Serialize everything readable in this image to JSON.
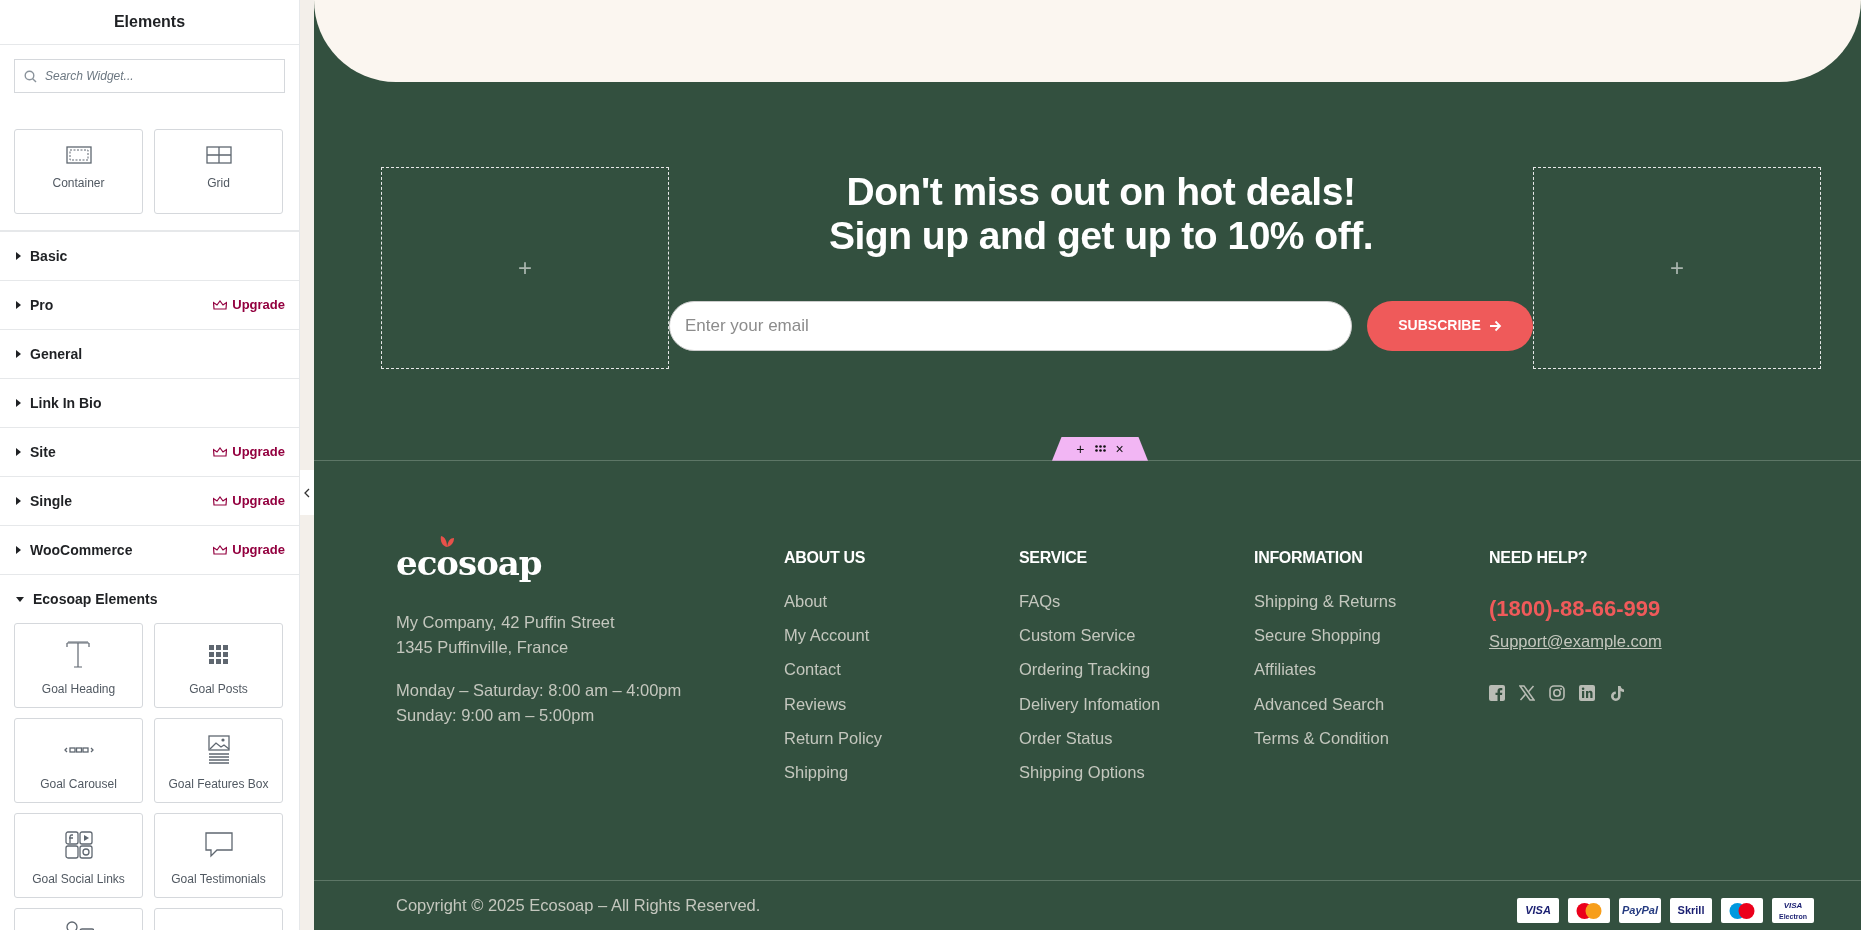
{
  "sidebar": {
    "title": "Elements",
    "search": {
      "placeholder": "Search Widget..."
    },
    "layout_widgets": [
      {
        "label": "Container"
      },
      {
        "label": "Grid"
      }
    ],
    "categories": [
      {
        "label": "Basic",
        "expanded": false
      },
      {
        "label": "Pro",
        "expanded": false,
        "badge": "Upgrade"
      },
      {
        "label": "General",
        "expanded": false
      },
      {
        "label": "Link In Bio",
        "expanded": false
      },
      {
        "label": "Site",
        "expanded": false,
        "badge": "Upgrade"
      },
      {
        "label": "Single",
        "expanded": false,
        "badge": "Upgrade"
      },
      {
        "label": "WooCommerce",
        "expanded": false,
        "badge": "Upgrade"
      },
      {
        "label": "Ecosoap Elements",
        "expanded": true
      }
    ],
    "widgets": [
      {
        "label": "Goal Heading"
      },
      {
        "label": "Goal Posts"
      },
      {
        "label": "Goal Carousel"
      },
      {
        "label": "Goal Features Box"
      },
      {
        "label": "Goal Social Links"
      },
      {
        "label": "Goal Testimonials"
      },
      {
        "kind": "cut"
      },
      {
        "kind": "cut"
      }
    ]
  },
  "newsletter": {
    "heading_lines": [
      "Don't miss out on hot deals!",
      "Sign up and get up to 10% off."
    ],
    "email": {
      "placeholder": "Enter your email"
    },
    "button": "SUBSCRIBE",
    "empty_columns": [
      "+",
      "+"
    ]
  },
  "section_handle": {
    "add": "+",
    "close": "×"
  },
  "footer": {
    "logo": "ecosoap",
    "address": [
      "My Company, 42 Puffin Street",
      "1345 Puffinville, France"
    ],
    "hours": [
      "Monday – Saturday: 8:00 am – 4:00pm",
      "Sunday: 9:00 am – 5:00pm"
    ],
    "columns": [
      {
        "heading": "ABOUT US",
        "links": [
          "About",
          "My Account",
          "Contact",
          "Reviews",
          "Return Policy",
          "Shipping"
        ]
      },
      {
        "heading": "SERVICE",
        "links": [
          "FAQs",
          "Custom Service",
          "Ordering Tracking",
          "Delivery Infomation",
          "Order Status",
          "Shipping Options"
        ]
      },
      {
        "heading": "INFORMATION",
        "links": [
          "Shipping & Returns",
          "Secure Shopping",
          "Affiliates",
          "Advanced Search",
          "Terms & Condition"
        ]
      }
    ],
    "help": {
      "heading": "NEED HELP?",
      "phone": "(1800)-88-66-999",
      "email": "Support@example.com"
    },
    "copyright": "Copyright © 2025 Ecosoap – All Rights Reserved.",
    "payments": [
      {
        "kind": "word",
        "label": "VISA"
      },
      {
        "kind": "circles"
      },
      {
        "kind": "word",
        "label": "PayPal"
      },
      {
        "kind": "word",
        "label": "Skrill"
      },
      {
        "kind": "circles"
      },
      {
        "kind": "stack",
        "label": "VISA",
        "sub": "Electron"
      }
    ]
  }
}
